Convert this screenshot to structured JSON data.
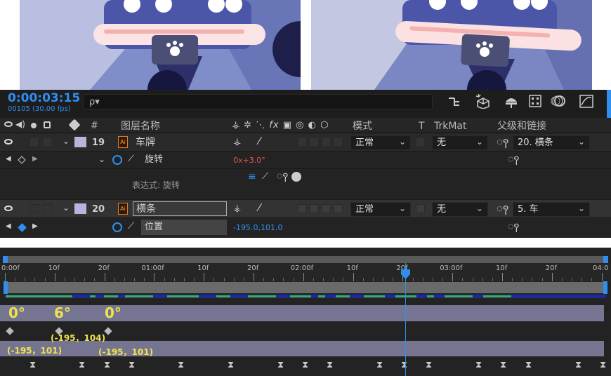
{
  "timeline": {
    "timecode": "0:00:03:15",
    "frame_info": "00105 (30.00 fps)",
    "search_placeholder": "ρ▾"
  },
  "columns": {
    "num": "#",
    "layer_name": "图层名称",
    "mode": "模式",
    "t": "T",
    "trkmat": "TrkMat",
    "parent": "父级和链接"
  },
  "layers": [
    {
      "num": "19",
      "name": "车牌",
      "mode": "正常",
      "trkmat": "无",
      "parent": "20. 横条",
      "prop_name": "旋转",
      "prop_value": "0x+3.0°",
      "expr_label": "表达式: 旋转"
    },
    {
      "num": "20",
      "name": "横条",
      "mode": "正常",
      "trkmat": "无",
      "parent": "5. 车",
      "prop_name": "位置",
      "prop_value": "-195.0,101.0"
    }
  ],
  "ruler": {
    "ticks": [
      "0:00f",
      "10f",
      "20f",
      "01:00f",
      "10f",
      "20f",
      "02:00f",
      "10f",
      "20f",
      "03:00f",
      "10f",
      "20f",
      "04:0"
    ],
    "playhead_label": "20"
  },
  "annotations": {
    "angle_1": "0°",
    "angle_2": "6°",
    "angle_3": "0°",
    "pos_1": "(-195，101)",
    "pos_2": "(-195，104)",
    "pos_3": "(-195，101)"
  },
  "colors": {
    "panel_bg": "#232323",
    "accent_blue": "#2f8ff0",
    "annotation_yellow": "#f0e34a",
    "keyframe_bar": "#1a2a9c",
    "keyframe_green": "#3cb043"
  }
}
